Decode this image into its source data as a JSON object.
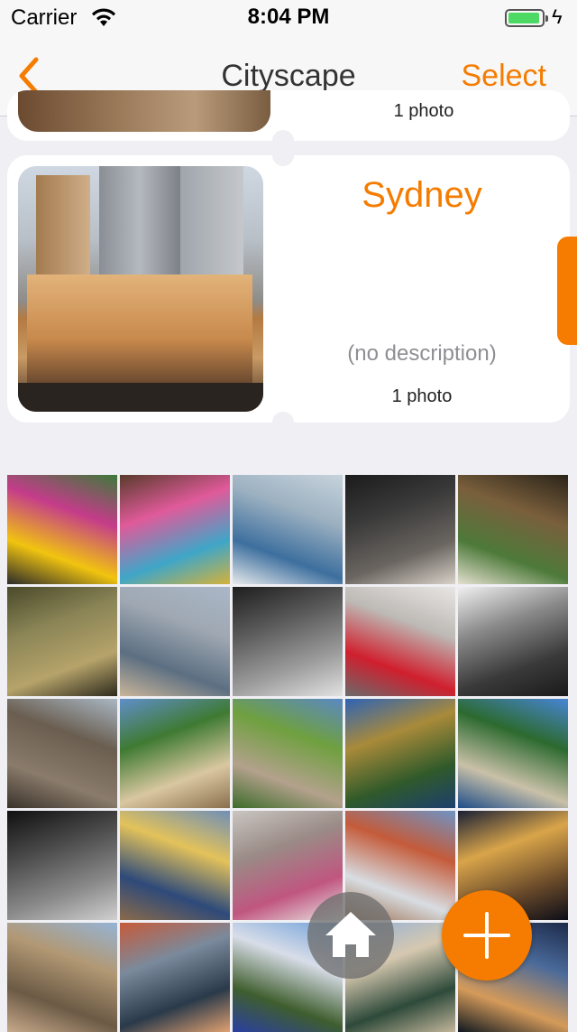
{
  "status_bar": {
    "carrier": "Carrier",
    "time": "8:04 PM",
    "wifi_icon": "wifi-icon",
    "battery_icon": "battery-icon",
    "charging_icon": "charging-bolt-icon",
    "battery_color": "#4cd964"
  },
  "navbar": {
    "back_icon": "chevron-left-icon",
    "title": "Cityscape",
    "select_label": "Select",
    "accent_color": "#f57c00"
  },
  "albums": [
    {
      "photo_count": "1 photo"
    },
    {
      "name": "Sydney",
      "description": "(no description)",
      "photo_count": "1 photo"
    }
  ],
  "photo_grid": {
    "columns": 5,
    "items": [
      {
        "colors": [
          "#3d7a3a",
          "#c43c8a",
          "#f1c40f",
          "#2a2a2a"
        ]
      },
      {
        "colors": [
          "#5a3b2b",
          "#e05a9a",
          "#3fa6c8",
          "#d4b23a"
        ]
      },
      {
        "colors": [
          "#c7d3dc",
          "#9bb0c0",
          "#3d6f9e",
          "#e6e9ec"
        ]
      },
      {
        "colors": [
          "#1b1b1b",
          "#3a3a3a",
          "#6a6560",
          "#d8d2c8"
        ]
      },
      {
        "colors": [
          "#2b2419",
          "#7a5f3c",
          "#4d7a3a",
          "#e4dfcf"
        ]
      },
      {
        "colors": [
          "#4a4a2a",
          "#8a8456",
          "#b5a36a",
          "#2e2a1d"
        ]
      },
      {
        "colors": [
          "#aab7c8",
          "#9fa8b2",
          "#5c6f82",
          "#c9b599"
        ]
      },
      {
        "colors": [
          "#1e1e1e",
          "#5a5a5a",
          "#9d9d9d",
          "#e2e2e2"
        ]
      },
      {
        "colors": [
          "#e8e6e4",
          "#bdb9b5",
          "#d01f2e",
          "#6a6a6a"
        ]
      },
      {
        "colors": [
          "#f0f0f0",
          "#8a8a8a",
          "#3a3a3a",
          "#1a1a1a"
        ]
      },
      {
        "colors": [
          "#a9b7c4",
          "#6a5e50",
          "#8a7b6b",
          "#3a332b"
        ]
      },
      {
        "colors": [
          "#5f8fc9",
          "#3f7a32",
          "#d9c7a0",
          "#8b6f4e"
        ]
      },
      {
        "colors": [
          "#5a88c4",
          "#6fa03f",
          "#b3a18c",
          "#3c6b2a"
        ]
      },
      {
        "colors": [
          "#2f63b5",
          "#a98a3a",
          "#305a2a",
          "#1c3f6e"
        ]
      },
      {
        "colors": [
          "#4785d6",
          "#2c6a2f",
          "#c9c0a8",
          "#1e4c88"
        ]
      },
      {
        "colors": [
          "#101010",
          "#4a4a4a",
          "#8a8a8a",
          "#d0d0d0"
        ]
      },
      {
        "colors": [
          "#6f8fb8",
          "#e3c25a",
          "#2e4a7a",
          "#8a6a4a"
        ]
      },
      {
        "colors": [
          "#c9c5c1",
          "#9a8b86",
          "#c05680",
          "#e8e4e0"
        ]
      },
      {
        "colors": [
          "#6e94c5",
          "#c45b3a",
          "#d8dde2",
          "#9b6b4a"
        ]
      },
      {
        "colors": [
          "#1a2036",
          "#d9a54a",
          "#6a4a2a",
          "#0c0e18"
        ]
      },
      {
        "colors": [
          "#95b4d6",
          "#b29874",
          "#6b5a45",
          "#c8a98a"
        ]
      },
      {
        "colors": [
          "#c65a3a",
          "#7a8a9c",
          "#2a3a4a",
          "#e0a070"
        ]
      },
      {
        "colors": [
          "#6ea0da",
          "#d8dde8",
          "#3f5e2e",
          "#2a3fa0"
        ]
      },
      {
        "colors": [
          "#8fb0d9",
          "#d6c8b0",
          "#2e4a3a",
          "#c2b59a"
        ]
      },
      {
        "colors": [
          "#1d2a4a",
          "#4a6a9a",
          "#d49a5a",
          "#101820"
        ]
      }
    ]
  },
  "fabs": {
    "home_icon": "home-icon",
    "add_icon": "plus-icon"
  }
}
